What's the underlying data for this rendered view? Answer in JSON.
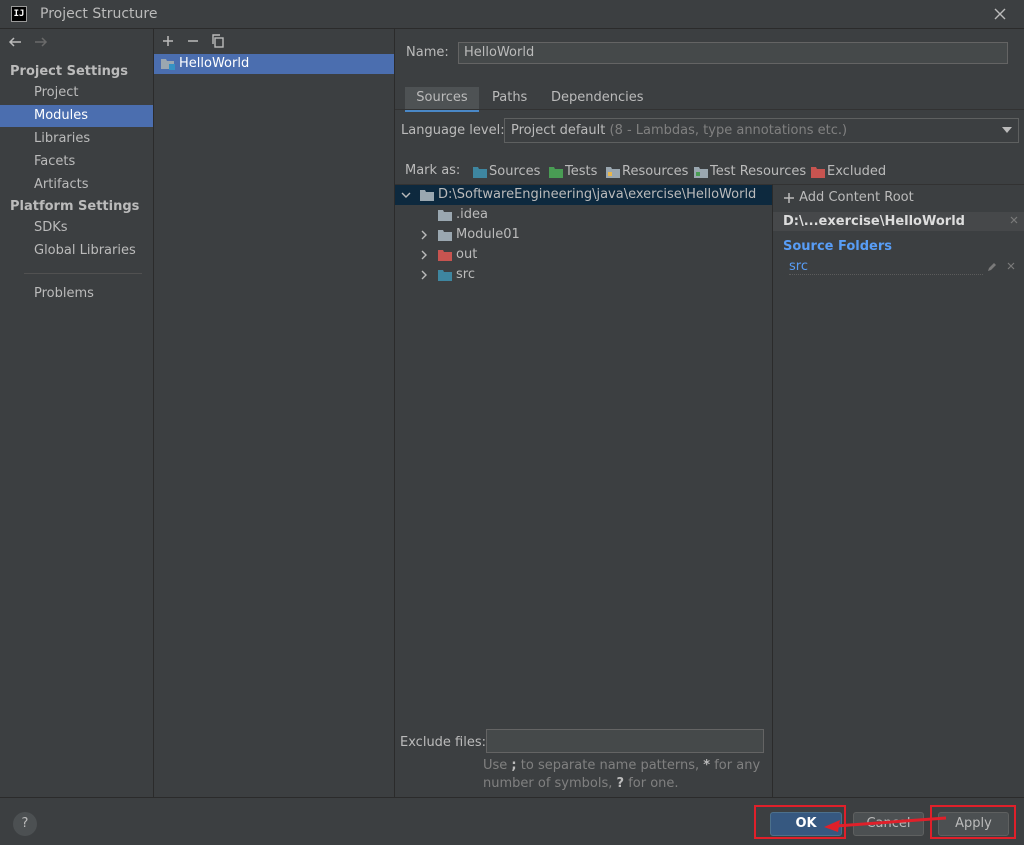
{
  "window": {
    "title": "Project Structure",
    "logo_text": "IJ"
  },
  "sidebar": {
    "project_settings_header": "Project Settings",
    "project_items": [
      {
        "label": "Project"
      },
      {
        "label": "Modules"
      },
      {
        "label": "Libraries"
      },
      {
        "label": "Facets"
      },
      {
        "label": "Artifacts"
      }
    ],
    "platform_settings_header": "Platform Settings",
    "platform_items": [
      {
        "label": "SDKs"
      },
      {
        "label": "Global Libraries"
      }
    ],
    "problems_label": "Problems",
    "selected": "Modules"
  },
  "modules": {
    "items": [
      {
        "label": "HelloWorld"
      }
    ]
  },
  "module_settings": {
    "name_label": "Name:",
    "name_value": "HelloWorld",
    "tabs": [
      {
        "label": "Sources"
      },
      {
        "label": "Paths"
      },
      {
        "label": "Dependencies"
      }
    ],
    "active_tab": "Sources",
    "language_level_label": "Language level:",
    "language_level_value": "Project default",
    "language_level_hint": "(8 - Lambdas, type annotations etc.)",
    "mark_as_label": "Mark as:",
    "mark_as": [
      {
        "label": "Sources",
        "color": "#3e86a0"
      },
      {
        "label": "Tests",
        "color": "#499c54"
      },
      {
        "label": "Resources",
        "color": "#9aa7b0"
      },
      {
        "label": "Test Resources",
        "color": "#9aa7b0"
      },
      {
        "label": "Excluded",
        "color": "#c75450"
      }
    ],
    "tree": {
      "root": "D:\\SoftwareEngineering\\java\\exercise\\HelloWorld",
      "children": [
        {
          "label": ".idea",
          "folder": "plain",
          "expandable": false
        },
        {
          "label": "Module01",
          "folder": "plain",
          "expandable": true
        },
        {
          "label": "out",
          "folder": "excluded",
          "expandable": true
        },
        {
          "label": "src",
          "folder": "source",
          "expandable": true
        }
      ]
    },
    "content_roots": {
      "add_label": "Add Content Root",
      "root_path": "D:\\...exercise\\HelloWorld",
      "source_folders_title": "Source Folders",
      "source_folders": [
        {
          "label": "src"
        }
      ]
    },
    "exclude_label": "Exclude files:",
    "exclude_value": "",
    "exclude_help_1": "Use ",
    "exclude_help_2": ";",
    "exclude_help_3": " to separate name patterns, ",
    "exclude_help_4": "*",
    "exclude_help_5": " for any number of symbols, ",
    "exclude_help_6": "?",
    "exclude_help_7": " for one."
  },
  "footer": {
    "help_label": "?",
    "ok_label": "OK",
    "cancel_label": "Cancel",
    "apply_label": "Apply"
  },
  "colors": {
    "selection": "#4b6eaf",
    "annotation_red": "#e0202a",
    "link_blue": "#589df6"
  }
}
